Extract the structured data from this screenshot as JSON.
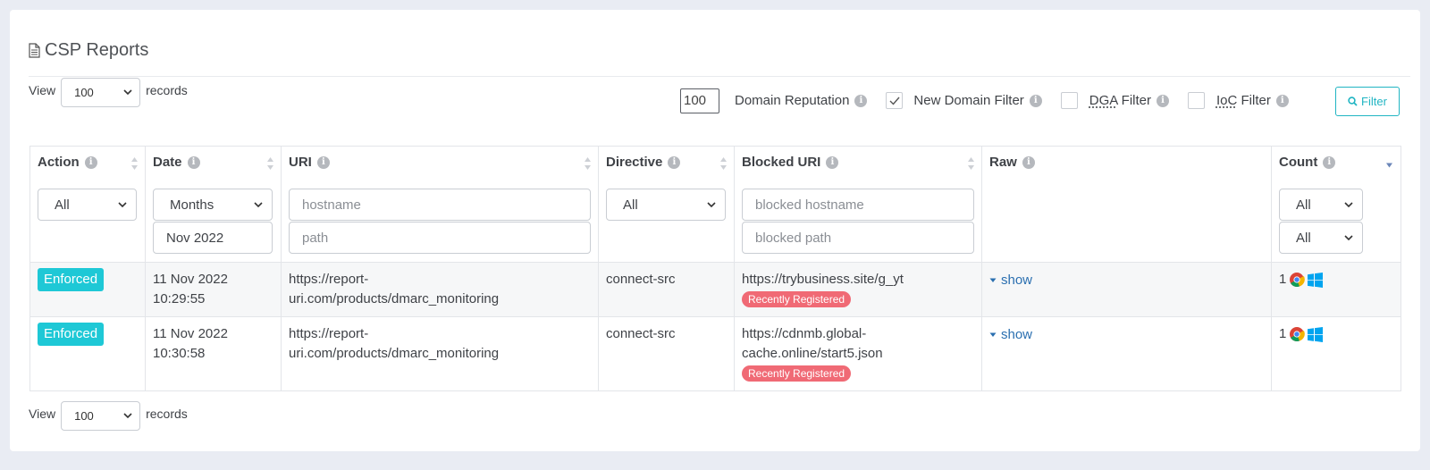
{
  "page": {
    "title": "CSP Reports",
    "title_icon": "document-icon"
  },
  "view_top": {
    "label_before": "View",
    "value": "100",
    "label_after": "records"
  },
  "view_bottom": {
    "label_before": "View",
    "value": "100",
    "label_after": "records"
  },
  "filters": {
    "reputation_value": "100",
    "domain_reputation_label": "Domain Reputation",
    "new_domain_label": "New Domain Filter",
    "new_domain_checked": true,
    "dga_label": "DGA",
    "dga_suffix": " Filter",
    "dga_checked": false,
    "ioc_label": "IoC",
    "ioc_suffix": " Filter",
    "ioc_checked": false,
    "filter_button_label": "Filter"
  },
  "columns": {
    "action": {
      "label": "Action",
      "filter_value": "All"
    },
    "date": {
      "label": "Date",
      "filter_value": "Months",
      "date_value": "Nov 2022"
    },
    "uri": {
      "label": "URI",
      "hostname_placeholder": "hostname",
      "path_placeholder": "path"
    },
    "directive": {
      "label": "Directive",
      "filter_value": "All"
    },
    "blocked_uri": {
      "label": "Blocked URI",
      "hostname_placeholder": "blocked hostname",
      "path_placeholder": "blocked path"
    },
    "raw": {
      "label": "Raw"
    },
    "count": {
      "label": "Count",
      "filter_value_1": "All",
      "filter_value_2": "All"
    }
  },
  "rows": [
    {
      "action": "Enforced",
      "date_line1": "11 Nov 2022",
      "date_line2": "10:29:55",
      "uri_line1": "https://report-",
      "uri_line2": "uri.com/products/dmarc_monitoring",
      "directive": "connect-src",
      "blocked_line1": "https://trybusiness.site/g_yt",
      "blocked_line2": "",
      "blocked_badge": "Recently Registered",
      "raw": "show",
      "count": "1"
    },
    {
      "action": "Enforced",
      "date_line1": "11 Nov 2022",
      "date_line2": "10:30:58",
      "uri_line1": "https://report-",
      "uri_line2": "uri.com/products/dmarc_monitoring",
      "directive": "connect-src",
      "blocked_line1": "https://cdnmb.global-",
      "blocked_line2": "cache.online/start5.json",
      "blocked_badge": "Recently Registered",
      "raw": "show",
      "count": "1"
    }
  ],
  "colors": {
    "accent": "#21b5c3",
    "enforced_badge": "#1ec8d6",
    "registered_badge": "#f06a75",
    "link": "#2a6fb0"
  }
}
